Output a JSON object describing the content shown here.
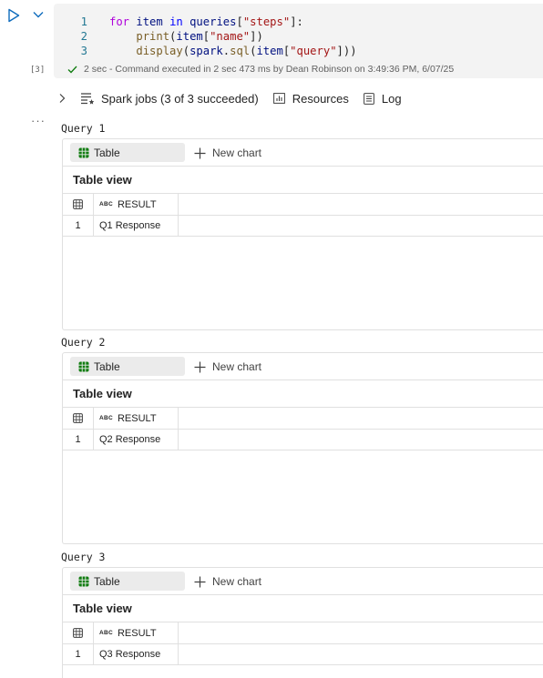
{
  "cell": {
    "execution_count": "[3]",
    "code_lines": [
      {
        "num": "1"
      },
      {
        "num": "2"
      },
      {
        "num": "3"
      }
    ],
    "code": {
      "l1_kw_for": "for",
      "l1_var_item": "item",
      "l1_kw_in": "in",
      "l1_var_queries": "queries",
      "l1_open": "[",
      "l1_str": "\"steps\"",
      "l1_close": "]:",
      "l2_fn_print": "print",
      "l2_open": "(",
      "l2_var_item": "item",
      "l2_b_open": "[",
      "l2_str": "\"name\"",
      "l2_close": "])",
      "l3_fn_display": "display",
      "l3_open": "(",
      "l3_var_spark": "spark",
      "l3_dot": ".",
      "l3_fn_sql": "sql",
      "l3_open2": "(",
      "l3_var_item": "item",
      "l3_b_open": "[",
      "l3_str": "\"query\"",
      "l3_close": "]))"
    },
    "status_text": "2 sec - Command executed in 2 sec 473 ms by Dean Robinson on 3:49:36 PM, 6/07/25"
  },
  "jobs_bar": {
    "spark_jobs_label": "Spark jobs (3 of 3 succeeded)",
    "resources_label": "Resources",
    "log_label": "Log"
  },
  "queries": [
    {
      "title": "Query 1",
      "tab_label": "Table",
      "new_chart_label": "New chart",
      "view_title": "Table view",
      "column_header": "RESULT",
      "row_index": "1",
      "row_value": "Q1 Response"
    },
    {
      "title": "Query 2",
      "tab_label": "Table",
      "new_chart_label": "New chart",
      "view_title": "Table view",
      "column_header": "RESULT",
      "row_index": "1",
      "row_value": "Q2 Response"
    },
    {
      "title": "Query 3",
      "tab_label": "Table",
      "new_chart_label": "New chart",
      "view_title": "Table view",
      "column_header": "RESULT",
      "row_index": "1",
      "row_value": "Q3 Response"
    }
  ],
  "column_type_badge": "ABC",
  "icons": {
    "run": "run-cell-icon",
    "collapse": "chevron-down-icon",
    "more": "more-options-icon",
    "success": "check-icon",
    "expand": "chevron-right-icon",
    "jobs": "spark-jobs-icon",
    "resources": "resources-chart-icon",
    "log": "log-icon",
    "table": "table-grid-icon",
    "new_chart": "plus-icon",
    "corner": "select-all-grid-icon"
  },
  "colors": {
    "accent": "#0f6cbd",
    "success": "#107c10",
    "table_icon": "#107c10",
    "code_background": "#f3f3f3"
  }
}
